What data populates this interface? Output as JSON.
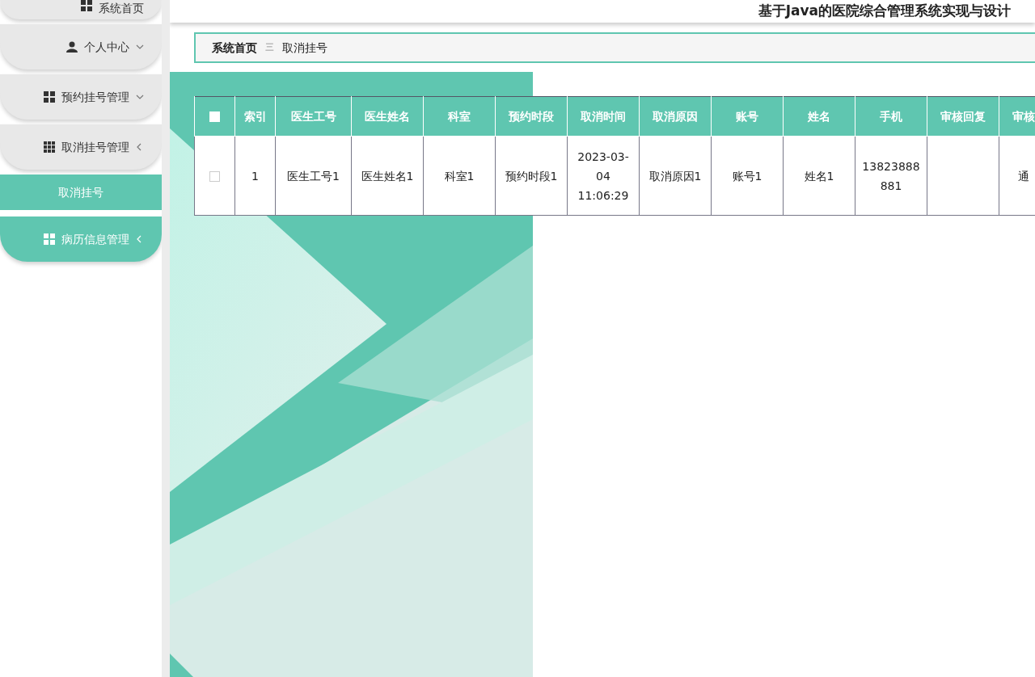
{
  "header": {
    "title": "基于Java的医院综合管理系统实现与设计"
  },
  "sidebar": {
    "items": [
      {
        "label": "系统首页",
        "active": false
      },
      {
        "label": "个人中心",
        "expanded": true,
        "active": false
      },
      {
        "label": "预约挂号管理",
        "expanded": true,
        "active": false
      },
      {
        "label": "取消挂号管理",
        "expanded": false,
        "active": false,
        "children": [
          {
            "label": "取消挂号",
            "selected": true
          }
        ]
      },
      {
        "label": "病历信息管理",
        "expanded": false,
        "active": true
      }
    ]
  },
  "breadcrumb": {
    "items": [
      "系统首页",
      "取消挂号"
    ],
    "separator": "三"
  },
  "table": {
    "select_all": {
      "checked": false
    },
    "columns": [
      "索引",
      "医生工号",
      "医生姓名",
      "科室",
      "预约时段",
      "取消时间",
      "取消原因",
      "账号",
      "姓名",
      "手机",
      "审核回复",
      "审核"
    ],
    "rows": [
      {
        "checked": false,
        "cells": [
          "1",
          "医生工号1",
          "医生姓名1",
          "科室1",
          "预约时段1",
          "2023-03-04 11:06:29",
          "取消原因1",
          "账号1",
          "姓名1",
          "13823888881",
          "",
          "通"
        ]
      }
    ]
  }
}
